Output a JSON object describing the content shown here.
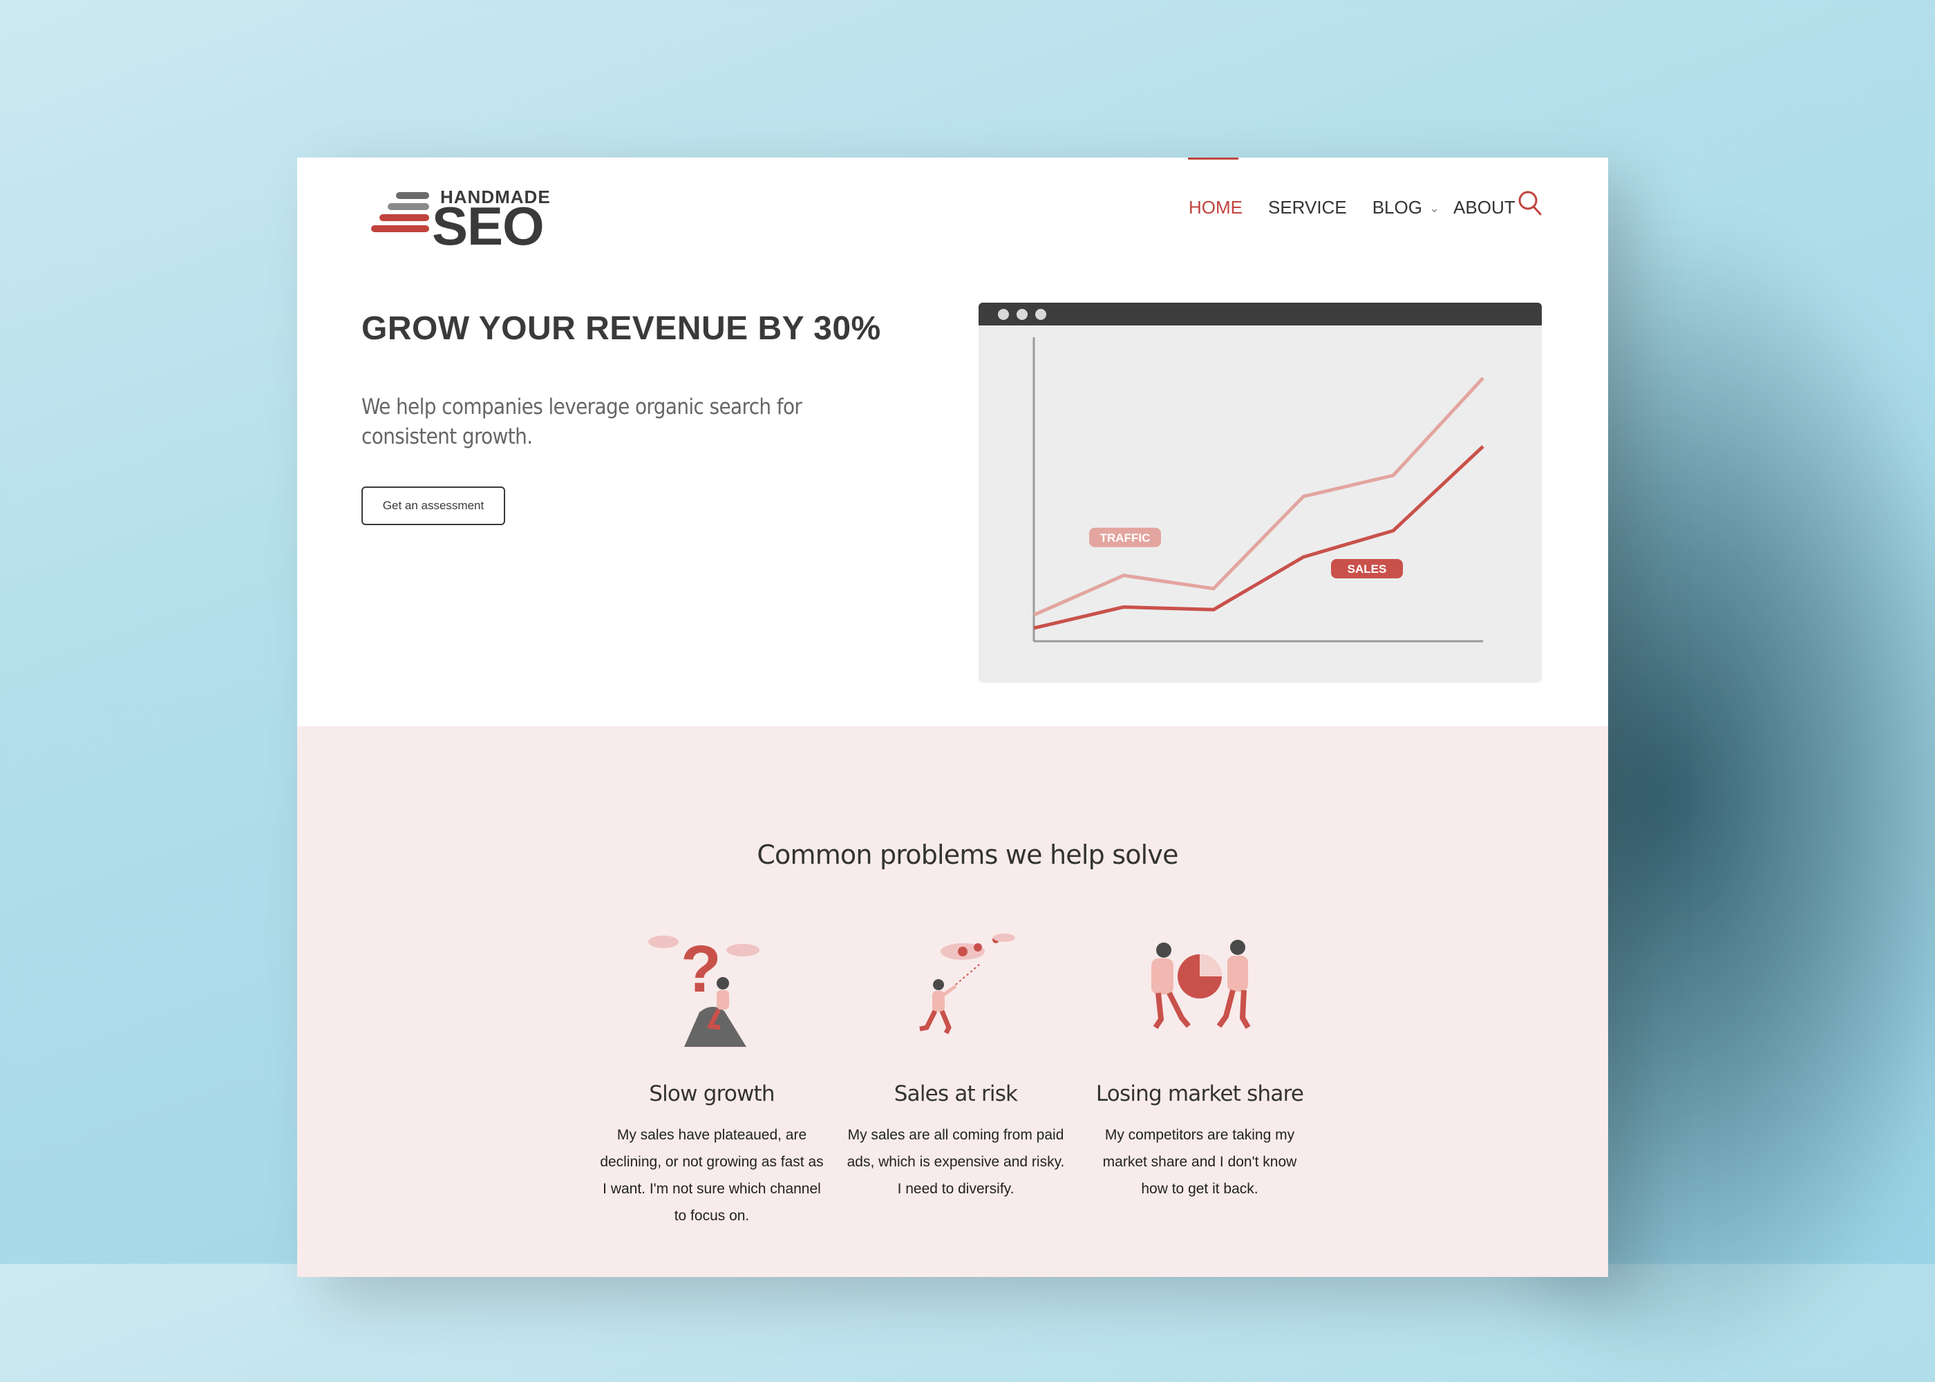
{
  "brand": {
    "logo_top": "HANDMADE",
    "logo_main": "SEO",
    "colors": {
      "accent": "#c0443d",
      "dark": "#3a3a3a",
      "pink_bg": "#f8ebeb",
      "traffic": "#e3a59f",
      "sales": "#c9514b"
    }
  },
  "nav": {
    "items": [
      {
        "label": "HOME",
        "active": true
      },
      {
        "label": "SERVICE",
        "active": false
      },
      {
        "label": "BLOG",
        "active": false,
        "has_dropdown": true
      },
      {
        "label": "ABOUT",
        "active": false
      }
    ],
    "search_icon": "search-icon"
  },
  "hero": {
    "title": "GROW YOUR REVENUE BY 30%",
    "subtitle": "We help companies leverage organic search for consistent growth.",
    "cta_label": "Get an assessment"
  },
  "chart_data": {
    "type": "line",
    "title": "",
    "xlabel": "",
    "ylabel": "",
    "grid": false,
    "legend": "inline labels",
    "series": [
      {
        "name": "TRAFFIC",
        "values": [
          1,
          2.5,
          2,
          5.5,
          6.3,
          10
        ]
      },
      {
        "name": "SALES",
        "values": [
          0.5,
          1.3,
          1.2,
          3.2,
          4.2,
          7.4
        ]
      }
    ],
    "ylim": [
      0,
      10.5
    ]
  },
  "problems": {
    "heading": "Common problems we help solve",
    "cards": [
      {
        "title": "Slow growth",
        "text": "My sales have plateaued, are declining, or not growing as fast as I want. I'm not sure which channel to focus on.",
        "icon": "confused-person-illustration"
      },
      {
        "title": "Sales at risk",
        "text": "My sales are all coming from paid ads, which is expensive and risky. I need to diversify.",
        "icon": "chasing-money-illustration"
      },
      {
        "title": "Losing market share",
        "text": "My competitors are taking my market share and I don't know how to get it back.",
        "icon": "pie-tug-of-war-illustration"
      }
    ]
  }
}
